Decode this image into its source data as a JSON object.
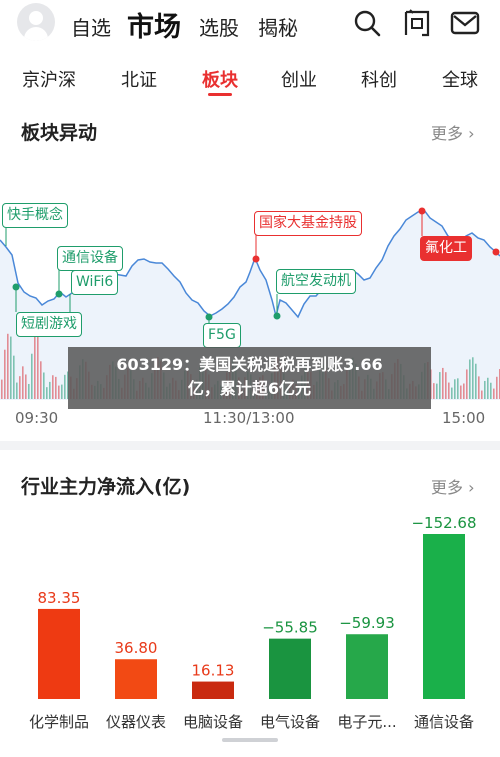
{
  "header": {
    "tabs": [
      {
        "label": "自选"
      },
      {
        "label": "市场"
      },
      {
        "label": "选股"
      },
      {
        "label": "揭秘"
      }
    ],
    "icons": [
      "search-icon",
      "question-icon",
      "mail-icon"
    ]
  },
  "categories": [
    {
      "label": "京沪深"
    },
    {
      "label": "北证"
    },
    {
      "label": "板块"
    },
    {
      "label": "创业"
    },
    {
      "label": "科创"
    },
    {
      "label": "全球"
    }
  ],
  "sector_moves": {
    "title": "板块异动",
    "more": "更多",
    "tags": [
      {
        "label": "快手概念"
      },
      {
        "label": "通信设备"
      },
      {
        "label": "WiFi6"
      },
      {
        "label": "短剧游戏"
      },
      {
        "label": "F5G"
      },
      {
        "label": "国家大基金持股"
      },
      {
        "label": "航空发动机"
      },
      {
        "label": "氟化工"
      }
    ],
    "time_axis": [
      "09:30",
      "11:30/13:00",
      "15:00"
    ],
    "colors": {
      "up": "#e93030",
      "down": "#1f9d6b",
      "line": "#4a88d8"
    }
  },
  "news_overlay": {
    "line1": "603129：美国关税退税再到账3.66",
    "line2": "亿，累计超6亿元"
  },
  "net_inflow": {
    "title": "行业主力净流入(亿)",
    "more": "更多"
  },
  "chart_data": {
    "type": "bar",
    "categories": [
      "化学制品",
      "仪器仪表",
      "电脑设备",
      "电气设备",
      "电子元...",
      "通信设备"
    ],
    "values": [
      83.35,
      36.8,
      16.13,
      -55.85,
      -59.93,
      -152.68
    ],
    "value_labels": [
      "83.35",
      "36.80",
      "16.13",
      "−55.85",
      "−59.93",
      "−152.68"
    ],
    "colors": [
      "#ee3a12",
      "#f24a14",
      "#c92a10",
      "#1a9440",
      "#26a84a",
      "#1ab04a"
    ],
    "title": "行业主力净流入(亿)",
    "xlabel": "",
    "ylabel": ""
  }
}
